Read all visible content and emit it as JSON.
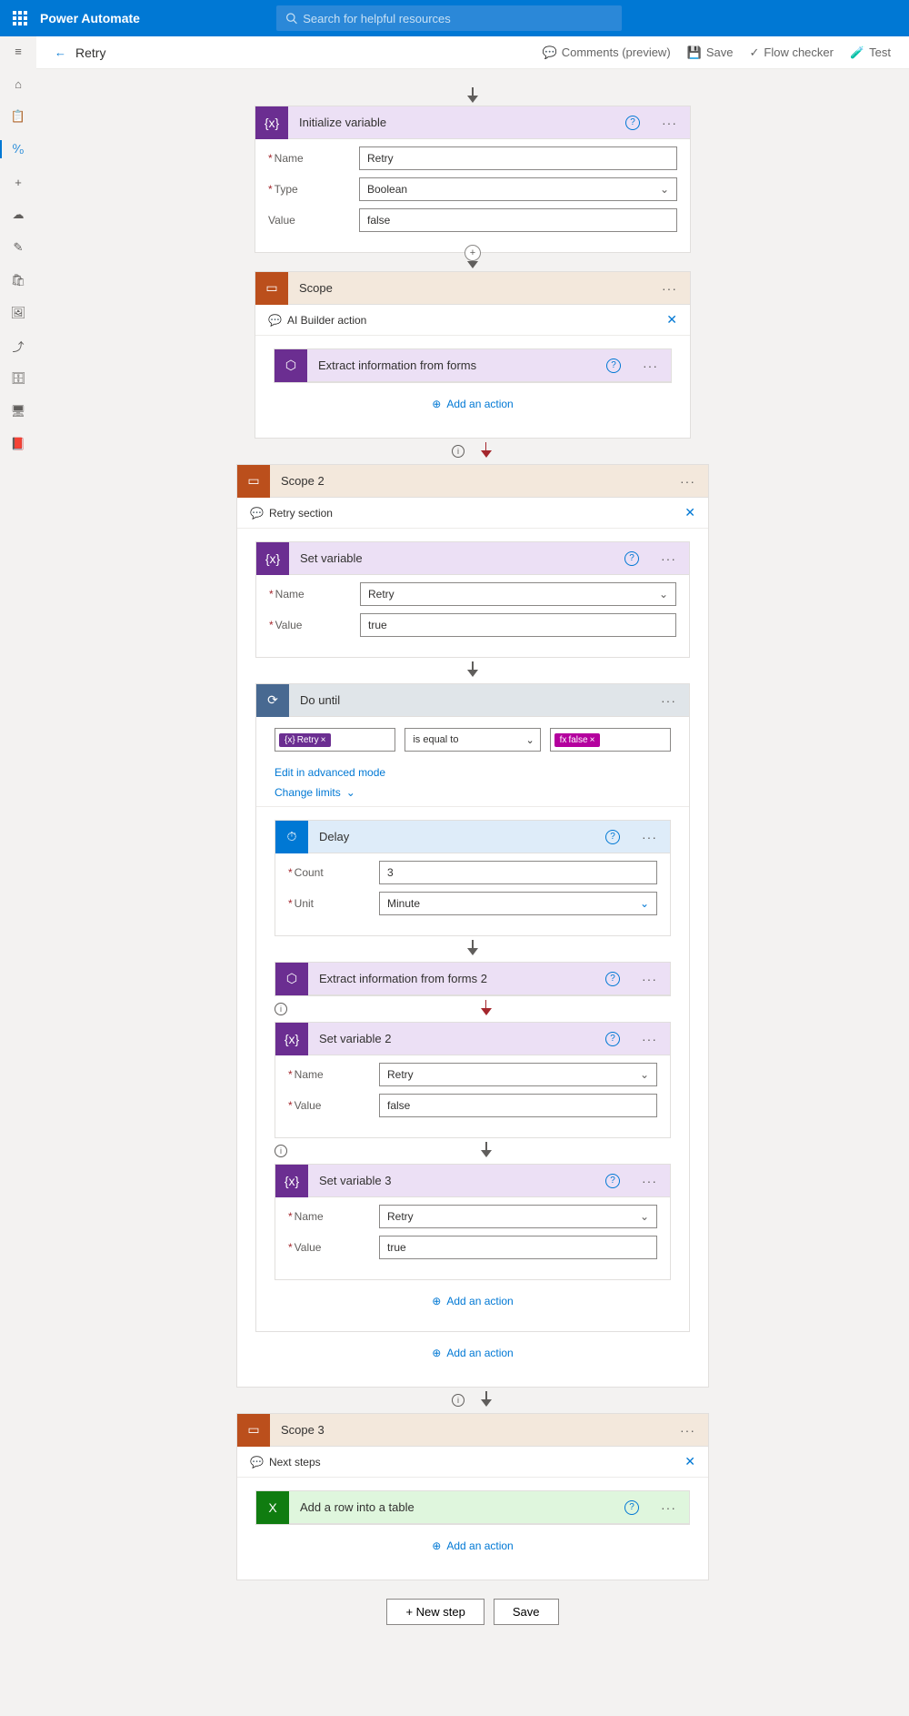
{
  "header": {
    "app_name": "Power Automate",
    "search_placeholder": "Search for helpful resources"
  },
  "cmdbar": {
    "title": "Retry",
    "comments": "Comments (preview)",
    "save": "Save",
    "flow_checker": "Flow checker",
    "test": "Test"
  },
  "init_var": {
    "title": "Initialize variable",
    "name_label": "Name",
    "name_value": "Retry",
    "type_label": "Type",
    "type_value": "Boolean",
    "value_label": "Value",
    "value_value": "false"
  },
  "scope1": {
    "title": "Scope",
    "comment": "AI Builder action",
    "action": "Extract information from forms",
    "add": "Add an action"
  },
  "scope2": {
    "title": "Scope 2",
    "comment": "Retry section",
    "set_var": {
      "title": "Set variable",
      "name_label": "Name",
      "name_value": "Retry",
      "value_label": "Value",
      "value_value": "true"
    },
    "do_until": {
      "title": "Do until",
      "var": "Retry",
      "op": "is equal to",
      "val": "false",
      "edit_mode": "Edit in advanced mode",
      "change_limits": "Change limits"
    },
    "delay": {
      "title": "Delay",
      "count_label": "Count",
      "count_value": "3",
      "unit_label": "Unit",
      "unit_value": "Minute"
    },
    "extract2": "Extract information from forms 2",
    "set_var2": {
      "title": "Set variable 2",
      "name_value": "Retry",
      "value_value": "false"
    },
    "set_var3": {
      "title": "Set variable 3",
      "name_value": "Retry",
      "value_value": "true"
    },
    "add": "Add an action"
  },
  "scope3": {
    "title": "Scope 3",
    "comment": "Next steps",
    "action": "Add a row into a table",
    "add": "Add an action"
  },
  "footer": {
    "new_step": "+ New step",
    "save": "Save"
  },
  "labels": {
    "name": "Name",
    "value": "Value"
  }
}
